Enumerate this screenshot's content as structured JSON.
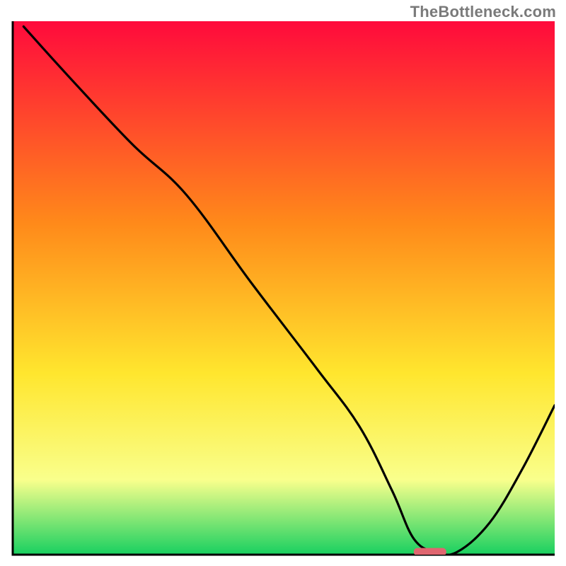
{
  "watermark": "TheBottleneck.com",
  "colors": {
    "curve": "#000000",
    "axis": "#000000",
    "marker_fill": "#e06670",
    "grad_top": "#ff0a3c",
    "grad_mid1": "#ff8a1a",
    "grad_mid2": "#ffe62e",
    "grad_mid3": "#f9ff8c",
    "grad_bot": "#18d060"
  },
  "chart_data": {
    "type": "line",
    "title": "",
    "xlabel": "",
    "ylabel": "",
    "xlim": [
      0,
      100
    ],
    "ylim": [
      0,
      100
    ],
    "x": [
      2,
      10,
      22,
      32,
      44,
      56,
      64,
      70,
      74,
      78,
      82,
      88,
      94,
      100
    ],
    "y": [
      99,
      90,
      77,
      67.5,
      51,
      35,
      24,
      12,
      3,
      0.5,
      0.5,
      6,
      16,
      28
    ],
    "marker": {
      "x_start": 74,
      "x_end": 80,
      "y": 0.6
    },
    "notes": "V-shaped bottleneck curve over rainbow gradient; minimum near x≈76–80. Values estimated from pixels; axes have no tick labels."
  }
}
